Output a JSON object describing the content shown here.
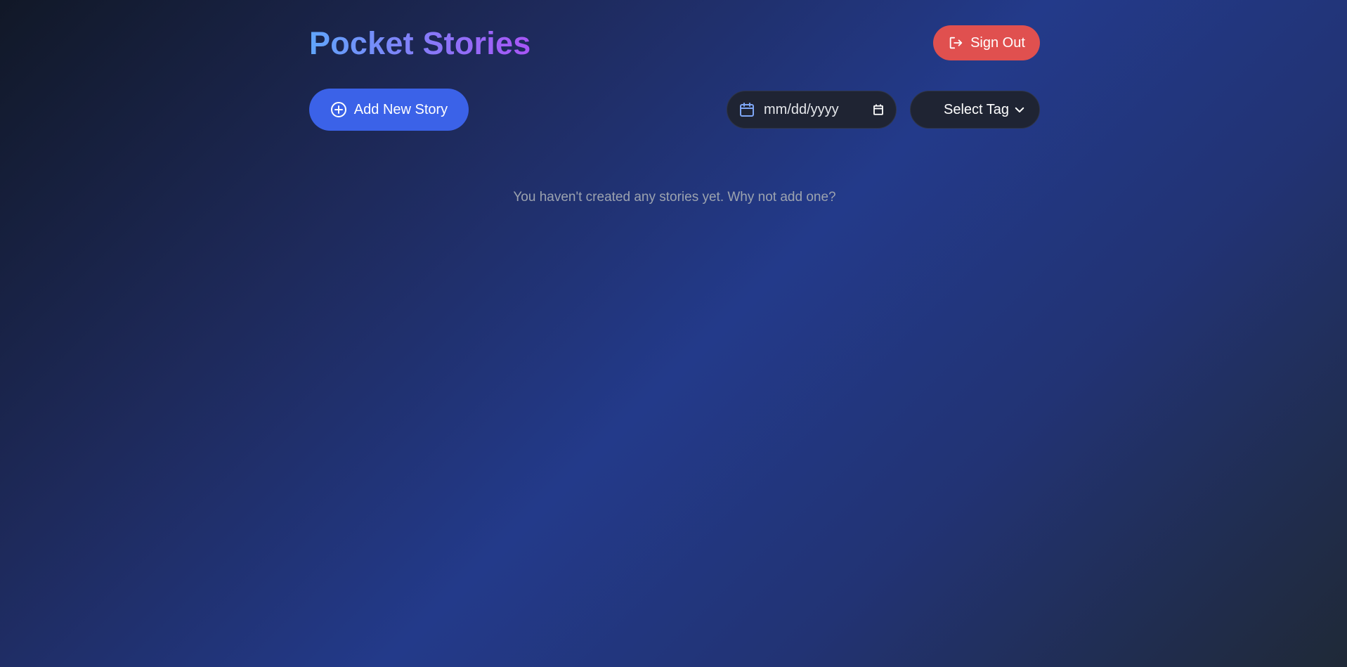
{
  "app": {
    "title": "Pocket Stories"
  },
  "header": {
    "signout_label": "Sign Out",
    "signout_icon": "sign-out-icon"
  },
  "toolbar": {
    "add_story_label": "Add New Story",
    "add_story_icon": "plus-circle-icon",
    "date_filter": {
      "placeholder": "mm/dd/yyyy",
      "icon": "calendar-icon",
      "picker_icon": "calendar-picker-icon"
    },
    "tag_select": {
      "selected": "Select Tag",
      "icon": "chevron-down-icon"
    }
  },
  "main": {
    "empty_message": "You haven't created any stories yet. Why not add one?"
  },
  "colors": {
    "title_gradient_start": "#60a5fa",
    "title_gradient_end": "#a855f7",
    "signout_bg": "#e0504f",
    "add_button_bg": "#3b62e8",
    "control_bg": "#1f2433",
    "muted_text": "#9ca3af"
  }
}
